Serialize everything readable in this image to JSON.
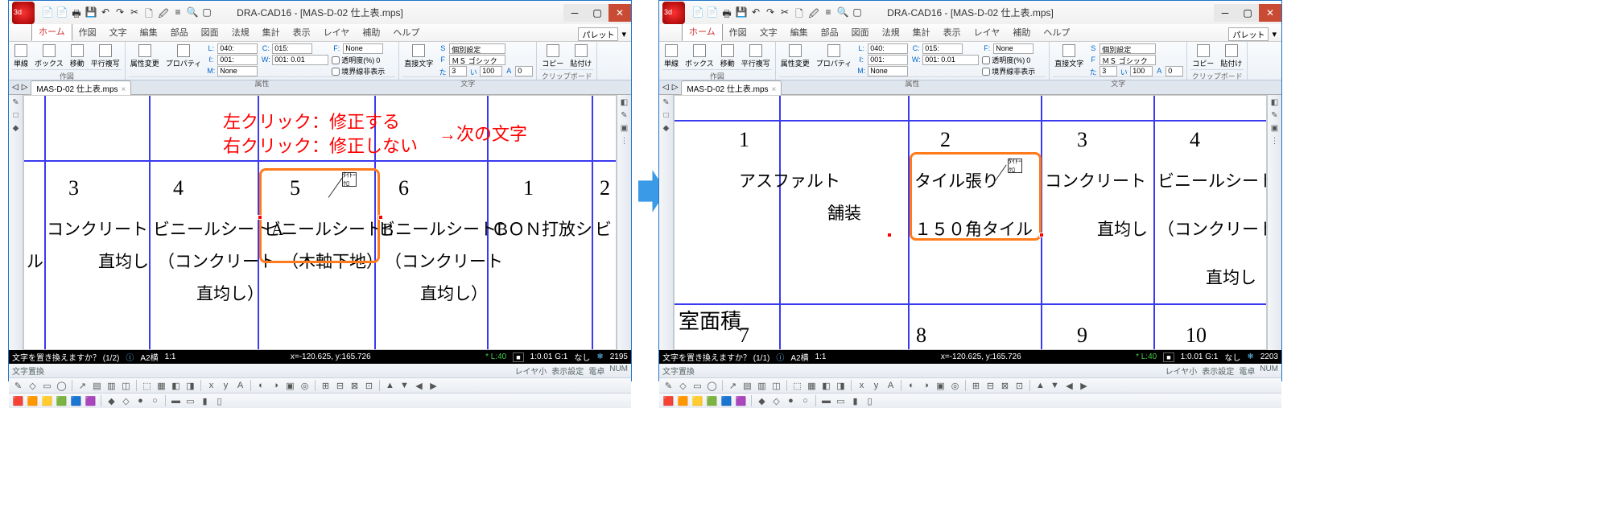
{
  "app": {
    "title": "DRA-CAD16 - [MAS-D-02 仕上表.mps]",
    "doc_tab": "MAS-D-02 仕上表.mps"
  },
  "qat": {
    "i0": "📄",
    "i1": "📄",
    "i2": "🖶",
    "i3": "💾",
    "i4": "↶",
    "i5": "↷",
    "i6": "✂",
    "i7": "🗋",
    "i8": "🖉",
    "i9": "≡",
    "i10": "🔍",
    "i11": "▢"
  },
  "tabs": {
    "t0": "ホーム",
    "t1": "作図",
    "t2": "文字",
    "t3": "編集",
    "t4": "部品",
    "t5": "図面",
    "t6": "法規",
    "t7": "集計",
    "t8": "表示",
    "t9": "レイヤ",
    "t10": "補助",
    "t11": "ヘルプ",
    "palette": "パレット",
    "dd": "▾"
  },
  "ribbon": {
    "g0": {
      "lbl": "作図",
      "b0": "単線",
      "b1": "ボックス",
      "b2": "移動",
      "b3": "平行複写"
    },
    "g1": {
      "lbl": "属性",
      "b0": "属性変更",
      "b1": "プロパティ",
      "L": "L:",
      "Lv": "040:",
      "C": "C:",
      "Cv": "015:",
      "Lt": "ℓ:",
      "Ltv": "001:",
      "W": "W:",
      "Wv": "001: 0.01",
      "M": "M:",
      "Mv": "None",
      "F": "F:",
      "Fv": "None",
      "chk_t": "透明度(%)",
      "tv": "0",
      "chk_b": "境界線非表示"
    },
    "g2": {
      "lbl": "文字",
      "b0": "直接文字",
      "font": "ＭＳ ゴシック",
      "ind": "個別設定",
      "Fh": "た",
      "Fhv": "3",
      "Fw": "い",
      "Fwv": "100",
      "Fx": "A",
      "Fxv": "0"
    },
    "g3": {
      "lbl": "クリップボード",
      "b0": "コピー",
      "b1": "貼付け"
    }
  },
  "status": {
    "prompt_left": "文字を置き換えますか？ (1/2)",
    "prompt_right": "文字を置き換えますか？ (1/1)",
    "layer": "A2横",
    "scale": "1:1",
    "coord": "x=-120.625, y:165.726",
    "L": "* L:40",
    "sq": "",
    "g": "1:0.01 G:1",
    "none": "なし",
    "snap": "❄",
    "num_l": "2195",
    "num_r": "2203"
  },
  "status2": {
    "l0": "文字置換",
    "r0": "レイヤ小",
    "r1": "表示設定",
    "r2": "電卓",
    "r3": "NUM"
  },
  "annotations": {
    "l1": "左クリック：修正する",
    "l2": "右クリック：修正しない",
    "arrow": "→次の文字"
  },
  "canvas_left": {
    "cols": [
      "3",
      "4",
      "5",
      "6",
      "1",
      "2"
    ],
    "row1": [
      "コンクリート",
      "ビニールシートA",
      "ビニールシートB",
      "ビニールシートB",
      "ＣＯＮ打放シ",
      "ビ"
    ],
    "row2_pre": "ル",
    "row2": [
      "直均し",
      "（コンクリート",
      "（木軸下地）",
      "（コンクリート",
      "",
      ""
    ],
    "row3": [
      "",
      "直均し）",
      "",
      "直均し）",
      "",
      ""
    ],
    "cursor": "ﾀｲﾄｰｸﾛ"
  },
  "canvas_right": {
    "cols": [
      "1",
      "2",
      "3",
      "4"
    ],
    "row0": "室面積",
    "row_b": [
      "7",
      "8",
      "9",
      "10"
    ],
    "c1a": "アスファルト",
    "c1b": "舗装",
    "c2a": "タイル張り",
    "c2b": "１５０角タイル",
    "c3a": "コンクリート",
    "c3b": "直均し",
    "c4a": "ビニールシート",
    "c4b": "（コンクリート",
    "c4c": "直均し"
  }
}
